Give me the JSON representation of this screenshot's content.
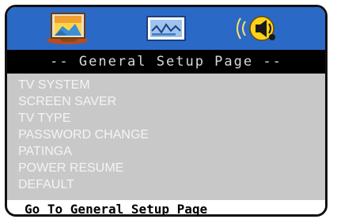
{
  "icons": {
    "general": "monitor-picture-icon",
    "video": "screen-wave-icon",
    "audio": "speaker-icon"
  },
  "title_bar": {
    "text": "-- General Setup Page --"
  },
  "menu": {
    "items": [
      {
        "label": "TV SYSTEM"
      },
      {
        "label": "SCREEN SAVER"
      },
      {
        "label": "TV TYPE"
      },
      {
        "label": "PASSWORD CHANGE"
      },
      {
        "label": "PATINGA"
      },
      {
        "label": "POWER RESUME"
      },
      {
        "label": "DEFAULT"
      }
    ]
  },
  "status": {
    "text": "Go To General Setup Page"
  },
  "colors": {
    "icon_bar": "#2b69c6",
    "title_bar": "#000000",
    "menu_bg": "#c8c8c8",
    "menu_text": "#f4f4f4"
  }
}
